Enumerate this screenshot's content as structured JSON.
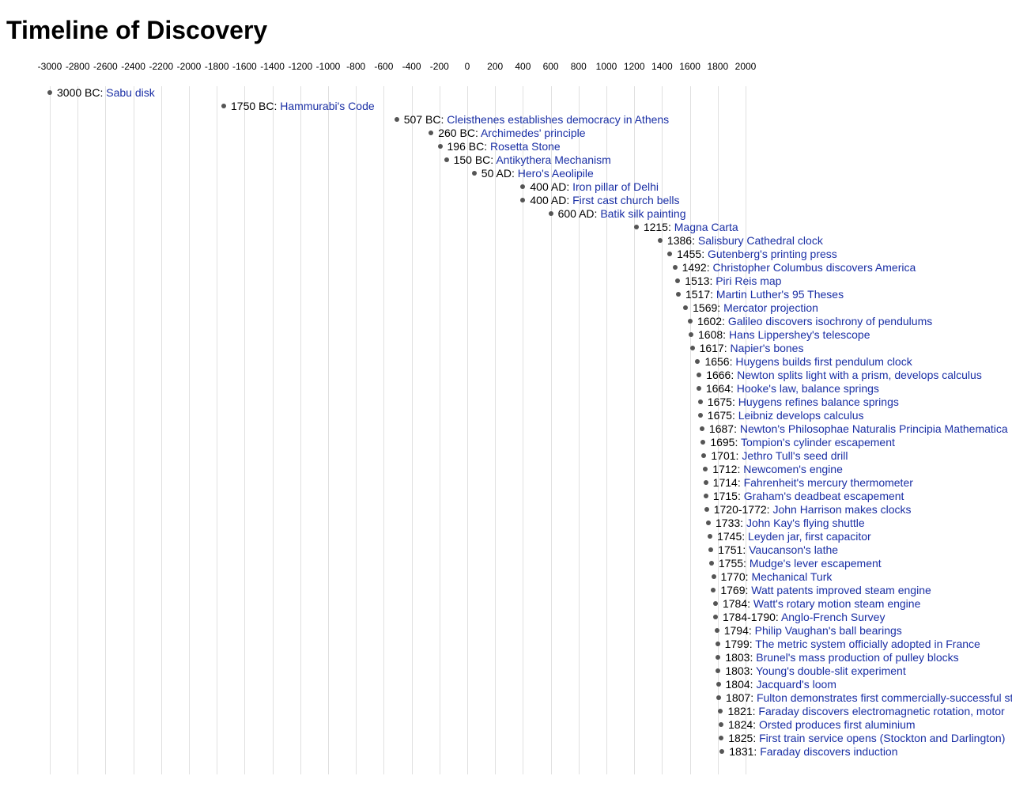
{
  "title": "Timeline of Discovery",
  "axis": {
    "start": -3000,
    "end": 2000,
    "step": 200,
    "plotLeftPx": 55,
    "plotRightPx": 935,
    "ticks": [
      -3000,
      -2800,
      -2600,
      -2400,
      -2200,
      -2000,
      -1800,
      -1600,
      -1400,
      -1200,
      -1000,
      -800,
      -600,
      -400,
      -200,
      0,
      200,
      400,
      600,
      800,
      1000,
      1200,
      1400,
      1600,
      1800,
      2000
    ]
  },
  "events": [
    {
      "year": -3000,
      "date": "3000 BC",
      "title": "Sabu disk"
    },
    {
      "year": -1750,
      "date": "1750 BC",
      "title": "Hammurabi's Code"
    },
    {
      "year": -507,
      "date": "507 BC",
      "title": "Cleisthenes establishes democracy in Athens"
    },
    {
      "year": -260,
      "date": "260 BC",
      "title": "Archimedes' principle"
    },
    {
      "year": -196,
      "date": "196 BC",
      "title": "Rosetta Stone"
    },
    {
      "year": -150,
      "date": "150 BC",
      "title": "Antikythera Mechanism"
    },
    {
      "year": 50,
      "date": "50 AD",
      "title": "Hero's Aeolipile"
    },
    {
      "year": 400,
      "date": "400 AD",
      "title": "Iron pillar of Delhi"
    },
    {
      "year": 400,
      "date": "400 AD",
      "title": "First cast church bells"
    },
    {
      "year": 600,
      "date": "600 AD",
      "title": "Batik silk painting"
    },
    {
      "year": 1215,
      "date": "1215",
      "title": "Magna Carta"
    },
    {
      "year": 1386,
      "date": "1386",
      "title": "Salisbury Cathedral clock"
    },
    {
      "year": 1455,
      "date": "1455",
      "title": "Gutenberg's printing press"
    },
    {
      "year": 1492,
      "date": "1492",
      "title": "Christopher Columbus discovers America"
    },
    {
      "year": 1513,
      "date": "1513",
      "title": "Piri Reis map"
    },
    {
      "year": 1517,
      "date": "1517",
      "title": "Martin Luther's 95 Theses"
    },
    {
      "year": 1569,
      "date": "1569",
      "title": "Mercator projection"
    },
    {
      "year": 1602,
      "date": "1602",
      "title": "Galileo discovers isochrony of pendulums"
    },
    {
      "year": 1608,
      "date": "1608",
      "title": "Hans Lippershey's telescope"
    },
    {
      "year": 1617,
      "date": "1617",
      "title": "Napier's bones"
    },
    {
      "year": 1656,
      "date": "1656",
      "title": "Huygens builds first pendulum clock"
    },
    {
      "year": 1666,
      "date": "1666",
      "title": "Newton splits light with a prism, develops calculus"
    },
    {
      "year": 1664,
      "date": "1664",
      "title": "Hooke's law, balance springs"
    },
    {
      "year": 1675,
      "date": "1675",
      "title": "Huygens refines balance springs"
    },
    {
      "year": 1675,
      "date": "1675",
      "title": "Leibniz develops calculus"
    },
    {
      "year": 1687,
      "date": "1687",
      "title": "Newton's Philosophae Naturalis Principia Mathematica"
    },
    {
      "year": 1695,
      "date": "1695",
      "title": "Tompion's cylinder escapement"
    },
    {
      "year": 1701,
      "date": "1701",
      "title": "Jethro Tull's seed drill"
    },
    {
      "year": 1712,
      "date": "1712",
      "title": "Newcomen's engine"
    },
    {
      "year": 1714,
      "date": "1714",
      "title": "Fahrenheit's mercury thermometer"
    },
    {
      "year": 1715,
      "date": "1715",
      "title": "Graham's deadbeat escapement"
    },
    {
      "year": 1720,
      "date": "1720-1772",
      "title": "John Harrison makes clocks"
    },
    {
      "year": 1733,
      "date": "1733",
      "title": "John Kay's flying shuttle"
    },
    {
      "year": 1745,
      "date": "1745",
      "title": "Leyden jar, first capacitor"
    },
    {
      "year": 1751,
      "date": "1751",
      "title": "Vaucanson's lathe"
    },
    {
      "year": 1755,
      "date": "1755",
      "title": "Mudge's lever escapement"
    },
    {
      "year": 1770,
      "date": "1770",
      "title": "Mechanical Turk"
    },
    {
      "year": 1769,
      "date": "1769",
      "title": "Watt patents improved steam engine"
    },
    {
      "year": 1784,
      "date": "1784",
      "title": "Watt's rotary motion steam engine"
    },
    {
      "year": 1784,
      "date": "1784-1790",
      "title": "Anglo-French Survey"
    },
    {
      "year": 1794,
      "date": "1794",
      "title": "Philip Vaughan's ball bearings"
    },
    {
      "year": 1799,
      "date": "1799",
      "title": "The metric system officially adopted in France"
    },
    {
      "year": 1803,
      "date": "1803",
      "title": "Brunel's mass production of pulley blocks"
    },
    {
      "year": 1803,
      "date": "1803",
      "title": "Young's double-slit experiment"
    },
    {
      "year": 1804,
      "date": "1804",
      "title": "Jacquard's loom"
    },
    {
      "year": 1807,
      "date": "1807",
      "title": "Fulton demonstrates first commercially-successful steamboat"
    },
    {
      "year": 1821,
      "date": "1821",
      "title": "Faraday discovers electromagnetic rotation, motor"
    },
    {
      "year": 1824,
      "date": "1824",
      "title": "Orsted produces first aluminium"
    },
    {
      "year": 1825,
      "date": "1825",
      "title": "First train service opens (Stockton and Darlington)"
    },
    {
      "year": 1831,
      "date": "1831",
      "title": "Faraday discovers induction"
    }
  ]
}
